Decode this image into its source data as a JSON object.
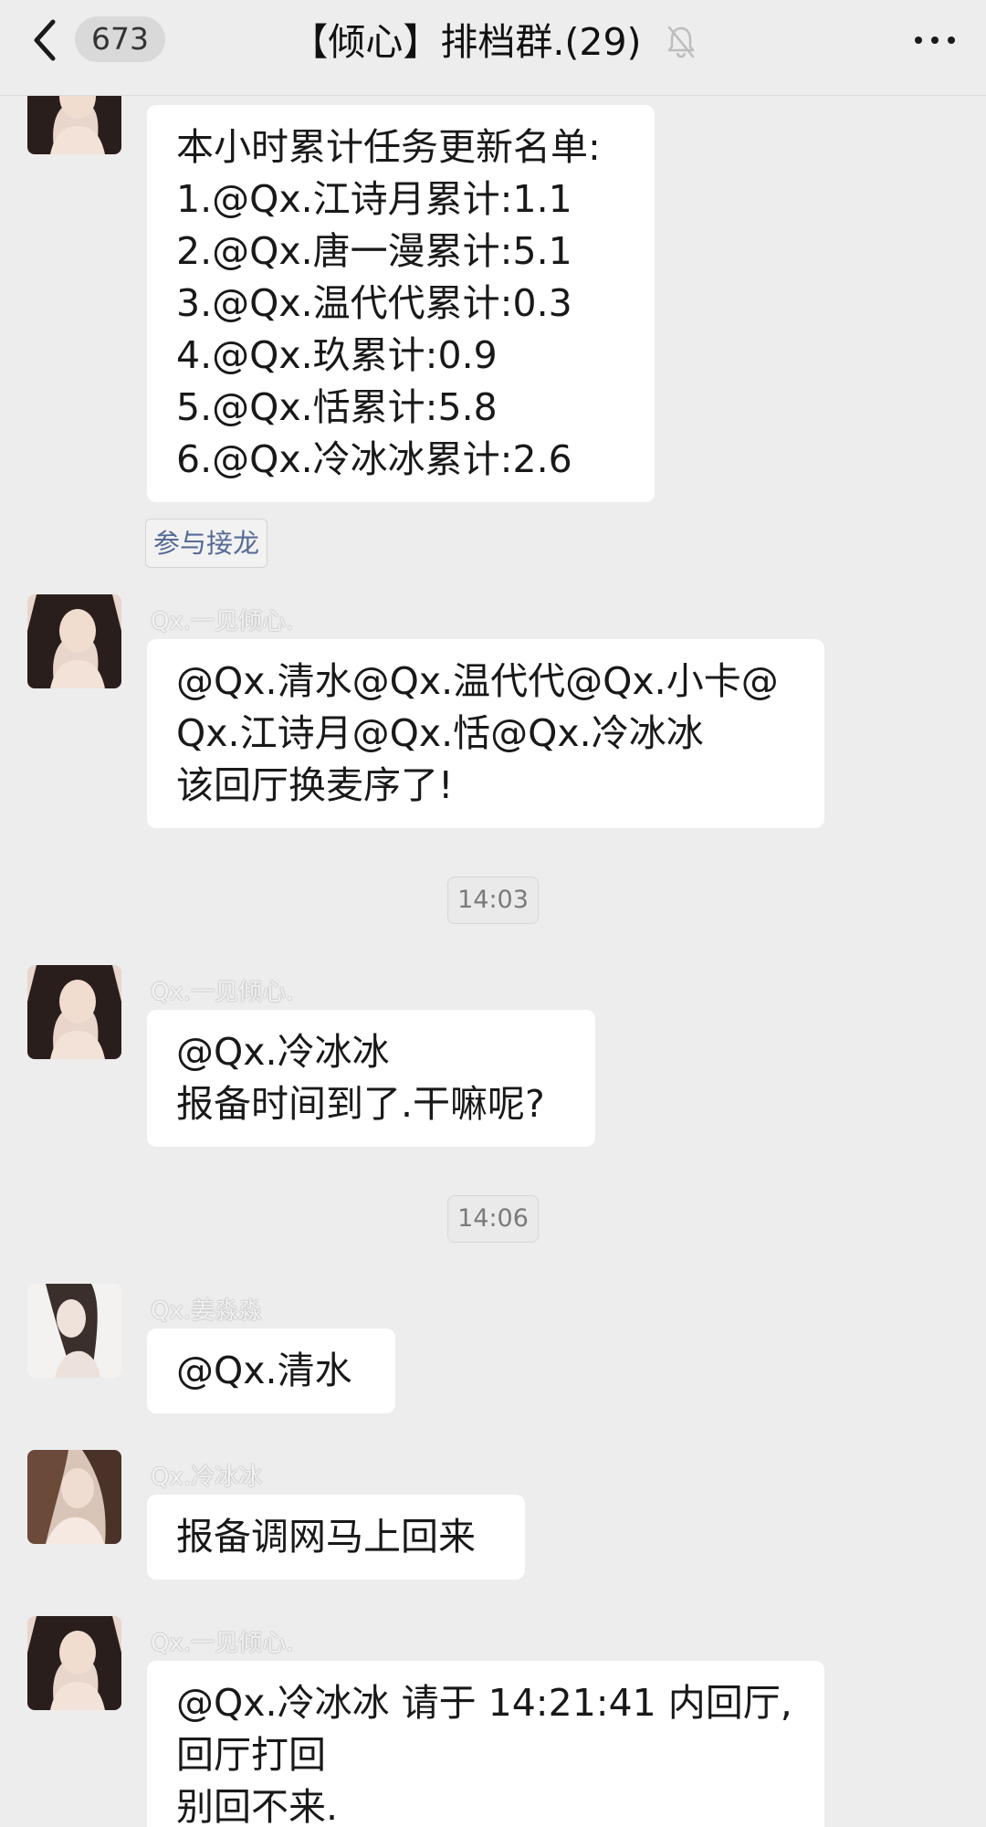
{
  "header": {
    "unread_count": "673",
    "title": "【倾心】排档群.(29)",
    "mute_icon": "bell-off-icon",
    "more_icon": "more-dots-icon"
  },
  "colors": {
    "background": "#ededed",
    "bubble": "#ffffff",
    "link_blue": "#576b95"
  },
  "messages": [
    {
      "sender": "",
      "lines": [
        "本小时累计任务更新名单:",
        "1.@Qx.江诗月累计:1.1",
        "2.@Qx.唐一漫累计:5.1",
        "3.@Qx.温代代累计:0.3",
        "4.@Qx.玖累计:0.9",
        "5.@Qx.恬累计:5.8",
        "6.@Qx.冷冰冰累计:2.6"
      ],
      "action": "参与接龙"
    },
    {
      "sender": "Qx.一见倾心.",
      "lines": [
        "@Qx.清水@Qx.温代代@Qx.小卡@",
        "Qx.江诗月@Qx.恬@Qx.冷冰冰",
        "该回厅换麦序了!"
      ]
    },
    {
      "sender": "Qx.一见倾心.",
      "lines": [
        "@Qx.冷冰冰",
        "报备时间到了.干嘛呢?"
      ]
    },
    {
      "sender": "Qx.姜淼淼",
      "lines": [
        "@Qx.清水"
      ]
    },
    {
      "sender": "Qx.冷冰冰",
      "lines": [
        "报备调网马上回来"
      ]
    },
    {
      "sender": "Qx.一见倾心.",
      "lines": [
        "@Qx.冷冰冰 请于 14:21:41 内回厅,",
        "回厅打回",
        "别回不来."
      ]
    }
  ],
  "timestamps": [
    "14:03",
    "14:06"
  ]
}
